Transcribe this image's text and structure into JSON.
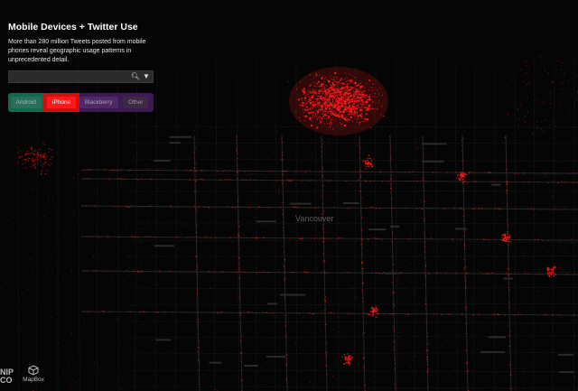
{
  "panel": {
    "title": "Mobile Devices + Twitter Use",
    "description": "More than 280 million Tweets posted from mobile phones reveal geographic usage patterns in unprecedented detail.",
    "search": {
      "value": "",
      "search_icon": "search-icon",
      "dropdown_icon": "caret-down-icon"
    },
    "filters": [
      {
        "label": "Android",
        "color": "#0f6a4e",
        "active": false
      },
      {
        "label": "iPhone",
        "color": "#d00e0e",
        "active": true
      },
      {
        "label": "Blackberry",
        "color": "#3e1a55",
        "active": false
      },
      {
        "label": "Other",
        "color": "#3e1a55",
        "active": false
      }
    ]
  },
  "map": {
    "city_label": "Vancouver",
    "point_color": "#ff1a1a",
    "background": "#050505"
  },
  "logos": {
    "partner_partial": "NIP\nCO",
    "mapbox": "MapBox"
  }
}
